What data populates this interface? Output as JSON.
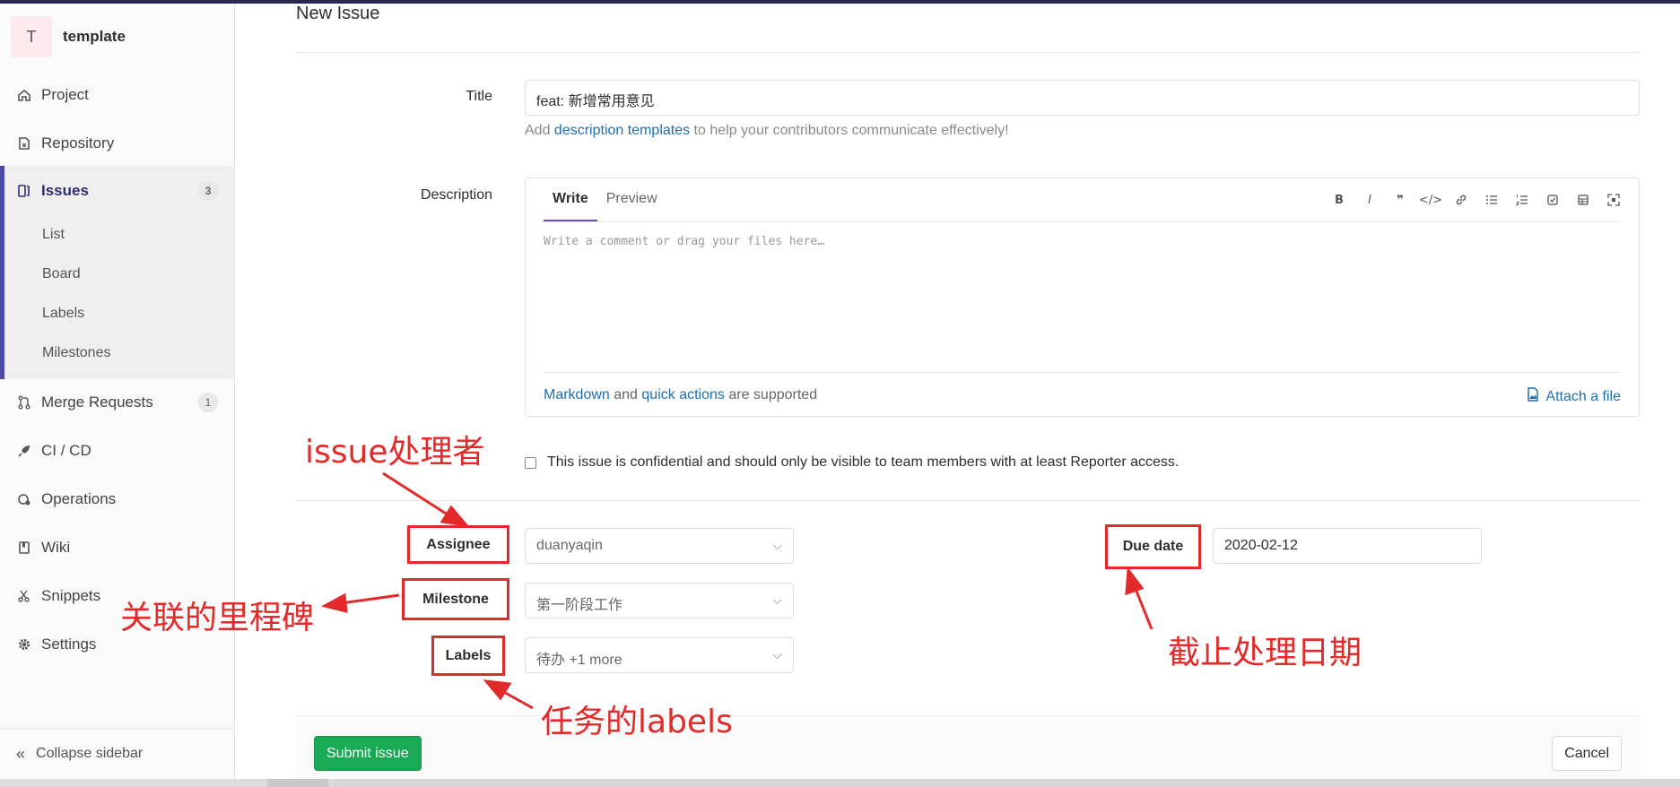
{
  "sidebar": {
    "project_initial": "T",
    "project_name": "template",
    "items": {
      "project": "Project",
      "repository": "Repository",
      "issues": "Issues",
      "issues_count": "3",
      "merge_requests": "Merge Requests",
      "merge_requests_count": "1",
      "cicd": "CI / CD",
      "operations": "Operations",
      "wiki": "Wiki",
      "snippets": "Snippets",
      "settings": "Settings"
    },
    "issues_sub": {
      "list": "List",
      "board": "Board",
      "labels": "Labels",
      "milestones": "Milestones"
    },
    "collapse": "Collapse sidebar"
  },
  "page": {
    "title": "New Issue"
  },
  "form": {
    "title_label": "Title",
    "title_value": "feat: 新增常用意见",
    "hint_prefix": "Add ",
    "hint_link": "description templates",
    "hint_suffix": " to help your contributors communicate effectively!",
    "description_label": "Description",
    "tab_write": "Write",
    "tab_preview": "Preview",
    "textarea_placeholder": "Write a comment or drag your files here…",
    "markdown_link": "Markdown",
    "and_text": " and ",
    "quick_actions_link": "quick actions",
    "supported_text": " are supported",
    "attach_label": "Attach a file",
    "confidential_text": "This issue is confidential and should only be visible to team members with at least Reporter access.",
    "assignee_label": "Assignee",
    "assignee_value": "duanyaqin",
    "milestone_label": "Milestone",
    "milestone_value": "第一阶段工作",
    "labels_label": "Labels",
    "labels_value": "待办 +1 more",
    "due_date_label": "Due date",
    "due_date_value": "2020-02-12",
    "submit_label": "Submit issue",
    "cancel_label": "Cancel"
  },
  "annotations": {
    "assignee_note": "issue处理者",
    "milestone_note": "关联的里程碑",
    "labels_note": "任务的labels",
    "due_date_note": "截止处理日期"
  },
  "colors": {
    "annotation": "#e32a2a",
    "submit": "#1aaa55",
    "link": "#1f6fb2",
    "active_nav": "#4b4ba3"
  }
}
